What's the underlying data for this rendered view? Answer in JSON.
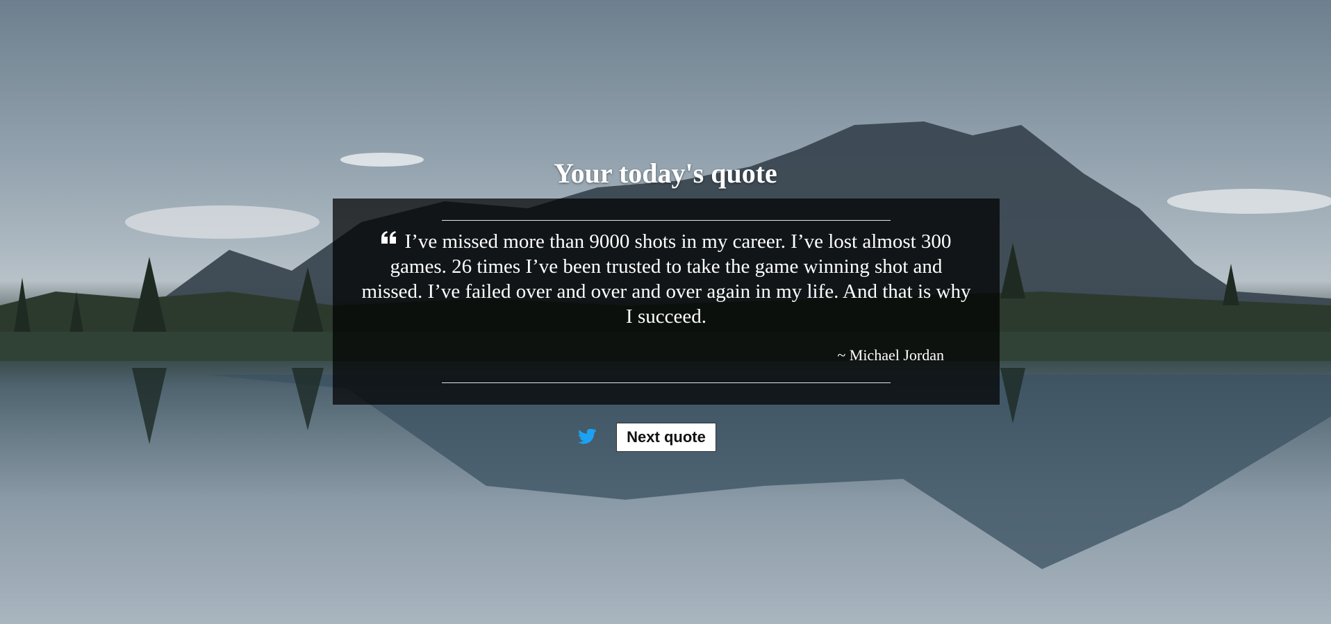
{
  "page": {
    "title": "Your today's quote"
  },
  "quote": {
    "text": "I’ve missed more than 9000 shots in my career. I’ve lost almost 300 games. 26 times I’ve been trusted to take the game winning shot and missed. I’ve failed over and over and over again in my life. And that is why I succeed.",
    "author": "~ Michael Jordan",
    "icon": "quote-left-icon"
  },
  "actions": {
    "tweet_icon": "twitter-icon",
    "next_label": "Next quote"
  },
  "colors": {
    "text": "#ffffff",
    "twitter": "#1da1f2",
    "box_background": "rgba(0,0,0,0.72)"
  }
}
